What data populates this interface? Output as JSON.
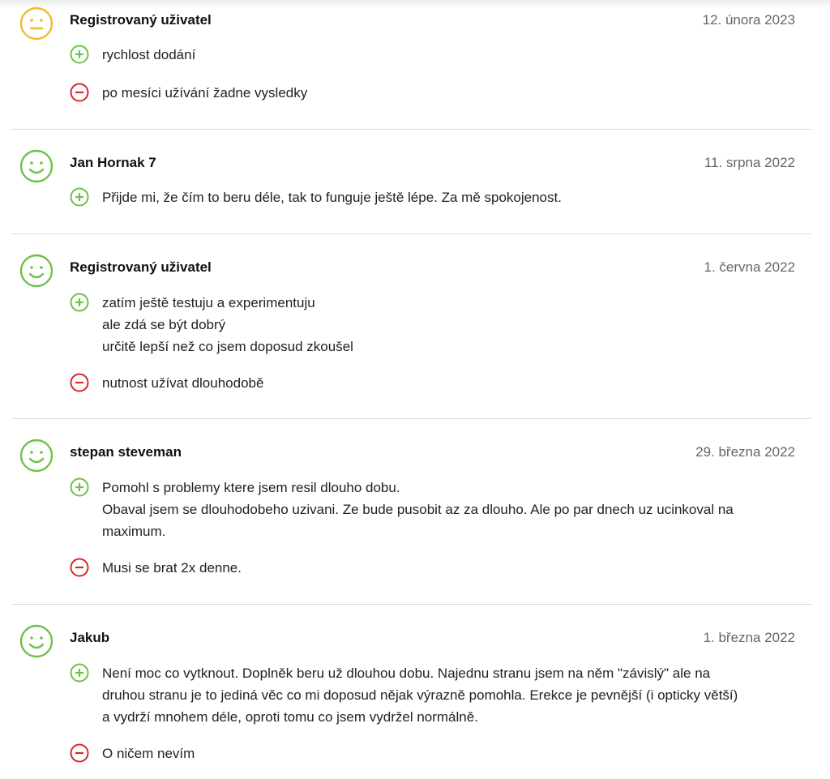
{
  "colors": {
    "positive": "#6cc24a",
    "negative": "#d8262f",
    "neutral": "#f5b82e"
  },
  "reviews": [
    {
      "mood": "neutral-face-icon",
      "author": "Registrovaný uživatel",
      "date": "12. února 2023",
      "pros": [
        "rychlost dodání"
      ],
      "cons": [
        "po mesíci užívání žadne vysledky"
      ]
    },
    {
      "mood": "smiley-face-icon",
      "author": "Jan Hornak 7",
      "date": "11. srpna 2022",
      "pros": [
        "Přijde mi, že čím to beru déle, tak to funguje ještě lépe. Za mě spokojenost."
      ],
      "cons": []
    },
    {
      "mood": "smiley-face-icon",
      "author": "Registrovaný uživatel",
      "date": "1. června 2022",
      "pros": [
        "zatím ještě testuju a experimentuju",
        "ale zdá se být dobrý",
        "určitě lepší než co jsem doposud zkoušel"
      ],
      "cons": [
        "nutnost užívat dlouhodobě"
      ]
    },
    {
      "mood": "smiley-face-icon",
      "author": "stepan steveman",
      "date": "29. března 2022",
      "pros": [
        "Pomohl s problemy ktere jsem resil dlouho dobu.",
        "Obaval jsem se dlouhodobeho uzivani. Ze bude pusobit az za dlouho. Ale po par dnech uz ucinkoval na",
        "maximum."
      ],
      "cons": [
        "Musi se brat 2x denne."
      ]
    },
    {
      "mood": "smiley-face-icon",
      "author": "Jakub",
      "date": "1. března 2022",
      "pros": [
        "Není moc co vytknout. Doplněk beru už dlouhou dobu. Najednu stranu jsem na něm \"závislý\" ale na",
        "druhou stranu je to jediná věc co mi doposud nějak výrazně pomohla. Erekce je pevnější (i opticky větší)",
        "a vydrží mnohem déle, oproti tomu co jsem vydržel normálně."
      ],
      "cons": [
        "O ničem nevím"
      ]
    }
  ]
}
